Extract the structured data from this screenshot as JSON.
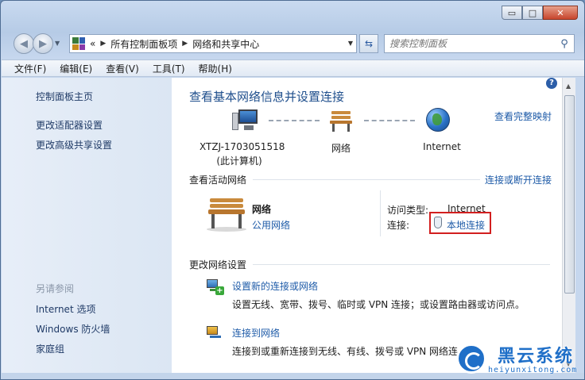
{
  "window": {
    "caption_buttons": {
      "minimize": "▭",
      "maximize": "□",
      "close": "✕"
    }
  },
  "navigation": {
    "breadcrumb_overflow": "«",
    "breadcrumbs": [
      "所有控制面板项",
      "网络和共享中心"
    ],
    "search_placeholder": "搜索控制面板"
  },
  "menu": [
    "文件(F)",
    "编辑(E)",
    "查看(V)",
    "工具(T)",
    "帮助(H)"
  ],
  "sidebar": {
    "links": [
      "控制面板主页",
      "更改适配器设置",
      "更改高级共享设置"
    ],
    "see_also_heading": "另请参阅",
    "see_also_links": [
      "Internet 选项",
      "Windows 防火墙",
      "家庭组"
    ]
  },
  "main": {
    "title": "查看基本网络信息并设置连接",
    "full_map_link": "查看完整映射",
    "map": {
      "computer_name": "XTZJ-1703051518",
      "computer_note": "(此计算机)",
      "network": "网络",
      "internet": "Internet"
    },
    "active_networks": {
      "heading": "查看活动网络",
      "connect_link": "连接或断开连接",
      "network_name": "网络",
      "network_type": "公用网络",
      "access_type_label": "访问类型:",
      "access_type_value": "Internet",
      "connections_label": "连接:",
      "connection_value": "本地连接"
    },
    "change_settings": {
      "heading": "更改网络设置",
      "tasks": [
        {
          "link": "设置新的连接或网络",
          "desc": "设置无线、宽带、拨号、临时或 VPN 连接；或设置路由器或访问点。"
        },
        {
          "link": "连接到网络",
          "desc": "连接到或重新连接到无线、有线、拨号或 VPN 网络连"
        }
      ]
    }
  },
  "watermark": {
    "name": "黑云系统",
    "url": "heiyunxitong.com"
  },
  "colors": {
    "link": "#1e5ba8",
    "title": "#1e4e8c",
    "highlight_box": "#d21f1f"
  }
}
